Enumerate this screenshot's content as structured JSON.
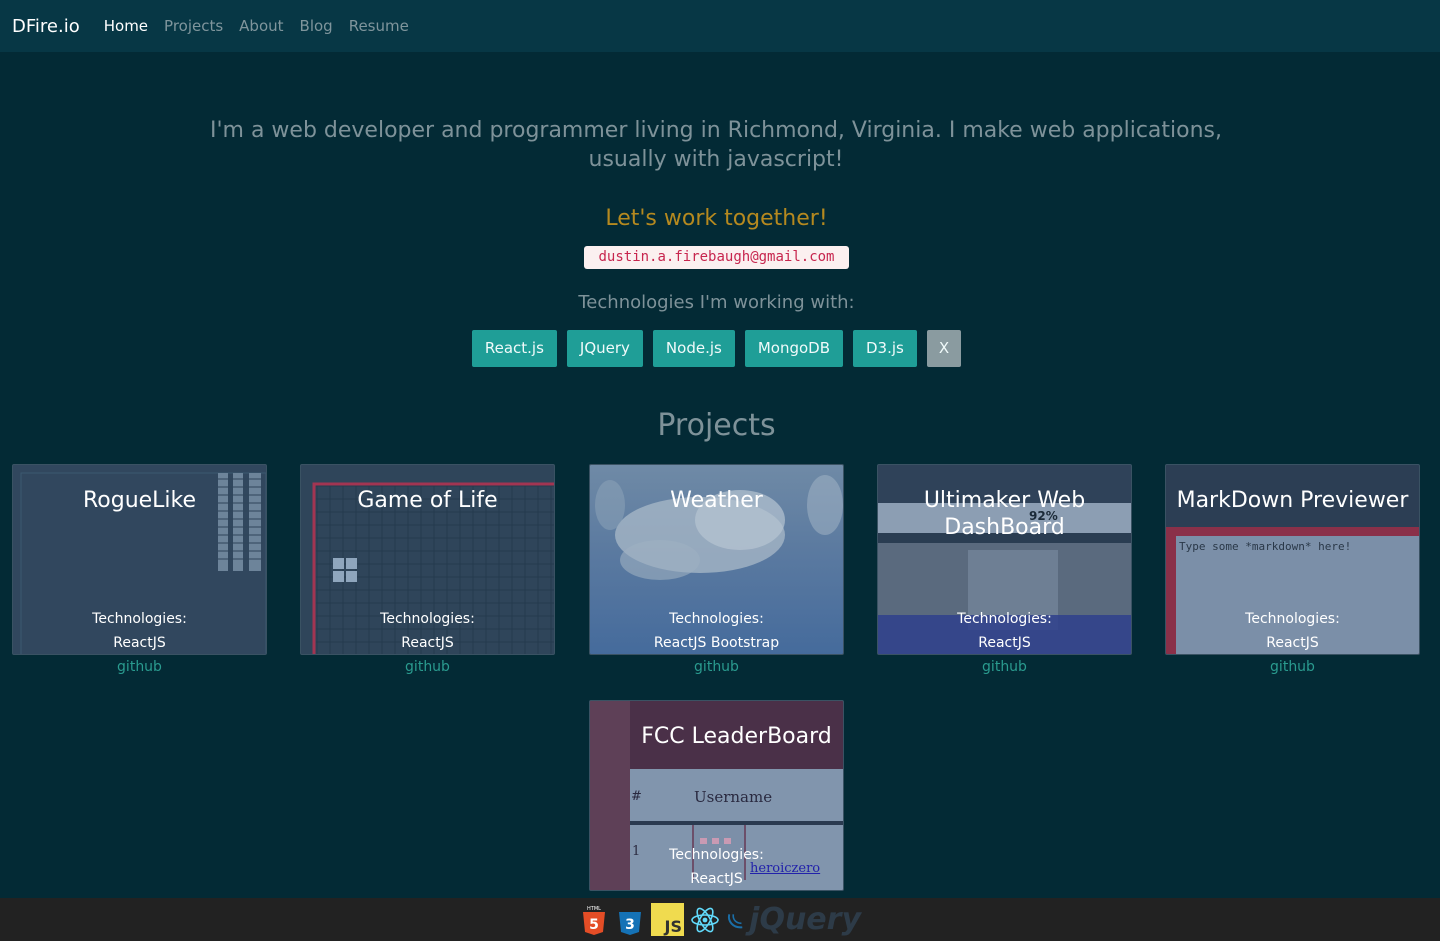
{
  "nav": {
    "brand": "DFire.io",
    "items": [
      {
        "label": "Home",
        "active": true
      },
      {
        "label": "Projects",
        "active": false
      },
      {
        "label": "About",
        "active": false
      },
      {
        "label": "Blog",
        "active": false
      },
      {
        "label": "Resume",
        "active": false
      }
    ]
  },
  "hero": {
    "intro": "I'm a web developer and programmer living in Richmond, Virginia. I make web applications, usually with javascript!",
    "cta": "Let's work together!",
    "email": "dustin.a.firebaugh@gmail.com",
    "tech_heading": "Technologies I'm working with:",
    "tech_buttons": [
      "React.js",
      "JQuery",
      "Node.js",
      "MongoDB",
      "D3.js",
      "X"
    ]
  },
  "projects": {
    "heading": "Projects",
    "items": [
      {
        "title": "RogueLike",
        "tech_label": "Technologies:",
        "tech": "ReactJS",
        "link": "github"
      },
      {
        "title": "Game of Life",
        "tech_label": "Technologies:",
        "tech": "ReactJS",
        "link": "github"
      },
      {
        "title": "Weather",
        "tech_label": "Technologies:",
        "tech": "ReactJS Bootstrap",
        "link": "github"
      },
      {
        "title": "Ultimaker Web DashBoard",
        "tech_label": "Technologies:",
        "tech": "ReactJS",
        "link": "github",
        "overlay_text": "92%"
      },
      {
        "title": "MarkDown Previewer",
        "tech_label": "Technologies:",
        "tech": "ReactJS",
        "link": "github",
        "overlay_text": "Type some *markdown* here!"
      },
      {
        "title": "FCC LeaderBoard",
        "tech_label": "Technologies:",
        "tech": "ReactJS",
        "overlay_hash": "#",
        "overlay_username": "Username",
        "overlay_rank": "1",
        "overlay_user": "heroiczero"
      }
    ]
  },
  "footer": {
    "icons": [
      "html5-icon",
      "css3-icon",
      "javascript-icon",
      "react-icon",
      "jquery-icon"
    ],
    "html5_text": "HTML",
    "js_text": "JS",
    "jquery_text": "jQuery"
  },
  "colors": {
    "background": "#032a35",
    "navbar": "#073745",
    "accent": "#1f9e97",
    "cta": "#b5891f"
  }
}
